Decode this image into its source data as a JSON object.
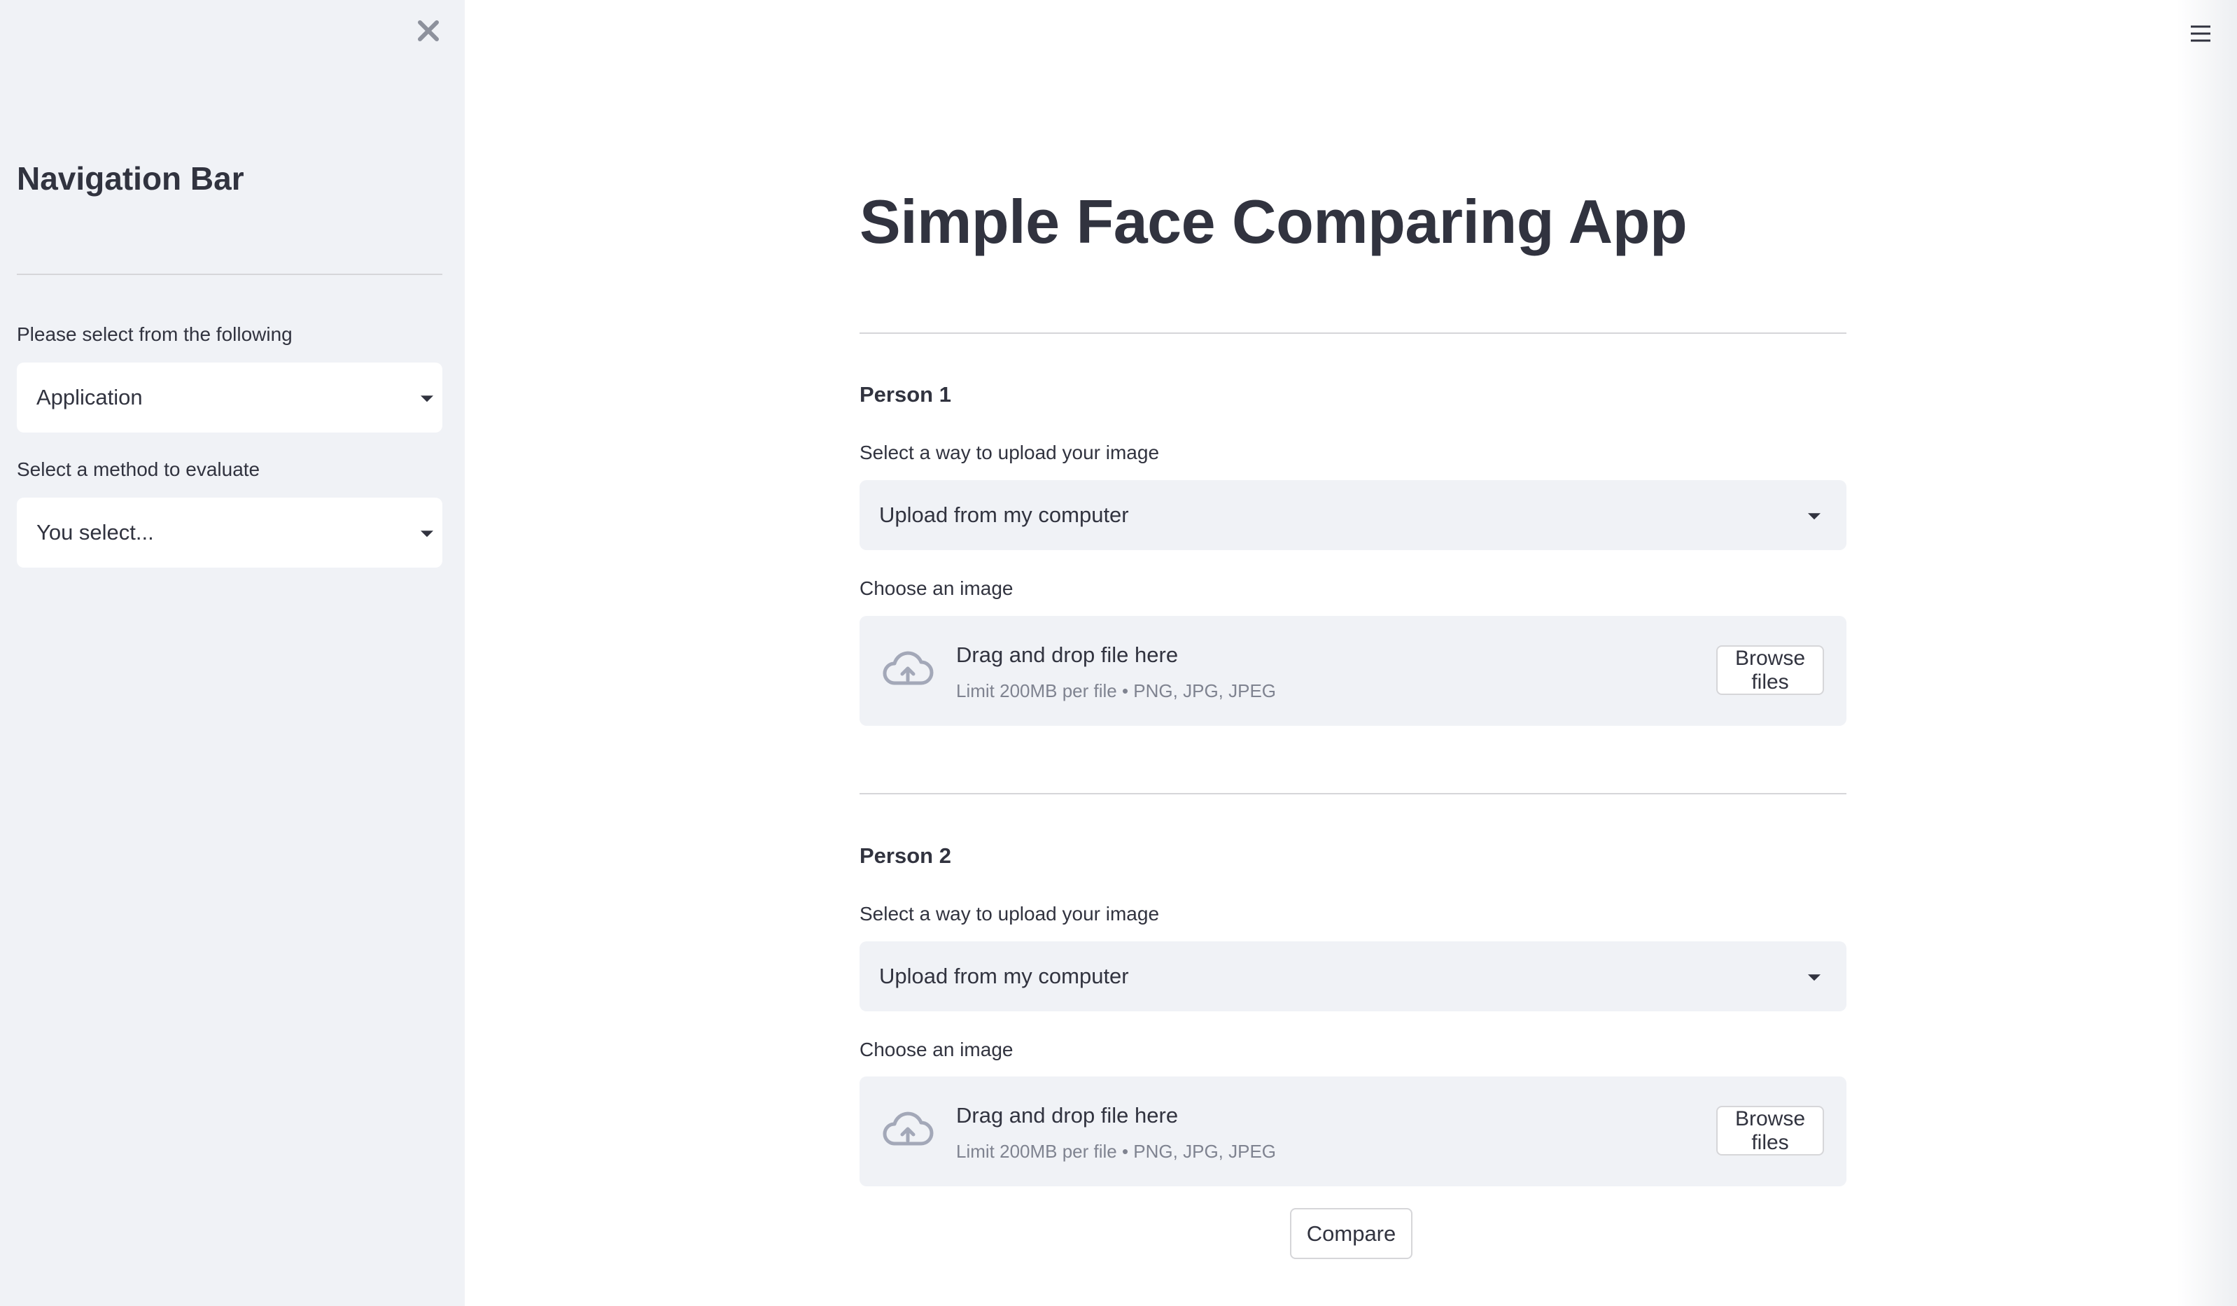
{
  "sidebar": {
    "title": "Navigation Bar",
    "close_icon": "close-icon",
    "select1": {
      "label": "Please select from the following",
      "value": "Application"
    },
    "select2": {
      "label": "Select a method to evaluate",
      "value": "You select..."
    }
  },
  "header": {
    "menu_icon": "hamburger-menu-icon"
  },
  "main": {
    "title": "Simple Face Comparing App",
    "persons": [
      {
        "heading": "Person 1",
        "upload_method_label": "Select a way to upload your image",
        "upload_method_value": "Upload from my computer",
        "choose_label": "Choose an image",
        "dropzone_text": "Drag and drop file here",
        "dropzone_limit": "Limit 200MB per file • PNG, JPG, JPEG",
        "browse_label": "Browse files"
      },
      {
        "heading": "Person 2",
        "upload_method_label": "Select a way to upload your image",
        "upload_method_value": "Upload from my computer",
        "choose_label": "Choose an image",
        "dropzone_text": "Drag and drop file here",
        "dropzone_limit": "Limit 200MB per file • PNG, JPG, JPEG",
        "browse_label": "Browse files"
      }
    ],
    "compare_label": "Compare"
  },
  "colors": {
    "sidebar_bg": "#f0f2f6",
    "text": "#31333f",
    "muted_text": "#7f8390",
    "icon": "#a3a8b8",
    "divider": "#d6d6d9"
  }
}
